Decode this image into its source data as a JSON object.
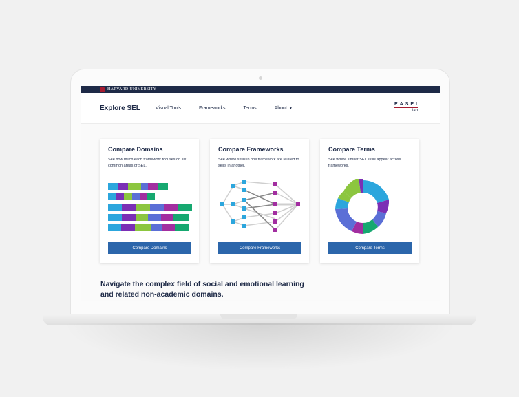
{
  "header": {
    "university": "HARVARD UNIVERSITY"
  },
  "nav": {
    "brand": "Explore SEL",
    "links": [
      "Visual Tools",
      "Frameworks",
      "Terms",
      "About"
    ],
    "logo_text": "EASEL",
    "logo_sub": "lab"
  },
  "cards": [
    {
      "title": "Compare Domains",
      "description": "See how much each framework focuses on six common areas of SEL.",
      "button": "Compare Domains",
      "icon": "stacked-bar-visual"
    },
    {
      "title": "Compare Frameworks",
      "description": "See where skills in one framework are related to skills in another.",
      "button": "Compare Frameworks",
      "icon": "network-visual"
    },
    {
      "title": "Compare Terms",
      "description": "See where similar SEL skills appear across frameworks.",
      "button": "Compare Terms",
      "icon": "sunburst-visual"
    }
  ],
  "tagline": "Navigate the complex field of social and emotional learning and related non-academic domains.",
  "colors": {
    "navy": "#1e2a47",
    "button": "#2c66ab",
    "crimson": "#a51c30",
    "cyan": "#2ca6dd",
    "purple": "#7b2fb5",
    "green": "#8cc63f",
    "blue": "#5b6fd6",
    "magenta": "#a22ea0",
    "teal": "#16a870"
  }
}
